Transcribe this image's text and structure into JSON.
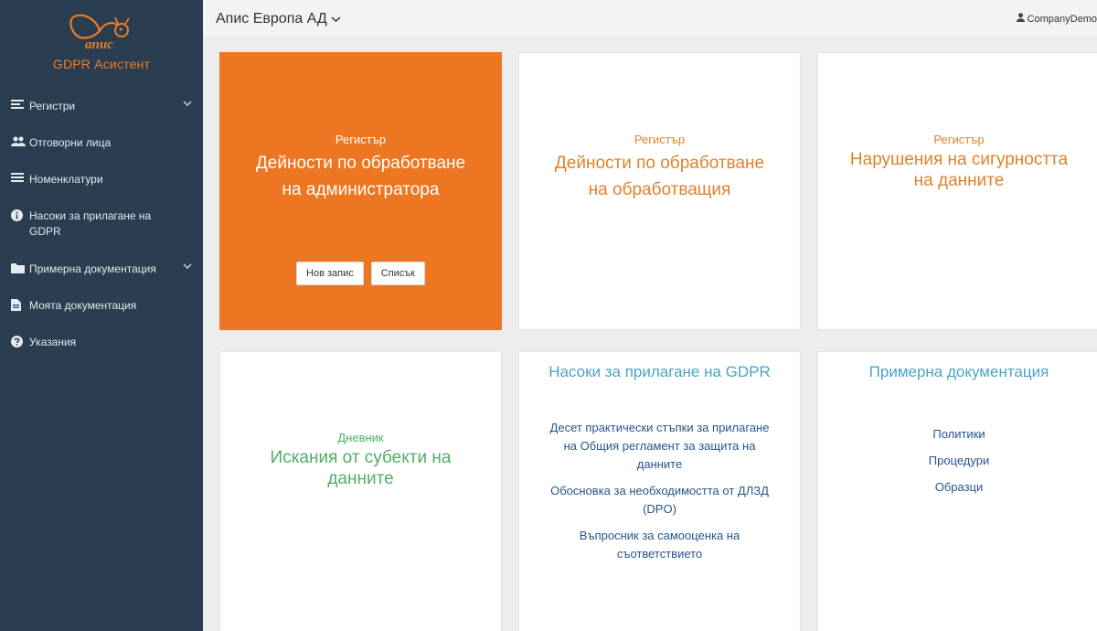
{
  "brand": {
    "logo_text": "апис",
    "title": "GDPR Асистент",
    "accent": "#ef7d22"
  },
  "sidebar": {
    "items": [
      {
        "icon": "list-icon",
        "label": "Регистри",
        "has_chevron": true
      },
      {
        "icon": "users-icon",
        "label": "Отговорни лица"
      },
      {
        "icon": "bars-icon",
        "label": "Номенклатури"
      },
      {
        "icon": "info-circle-icon",
        "label": "Насоки за прилагане на GDPR"
      },
      {
        "icon": "folder-icon",
        "label": "Примерна документация",
        "has_chevron": true
      },
      {
        "icon": "file-icon",
        "label": "Моята документация"
      },
      {
        "icon": "question-circle-icon",
        "label": "Указания"
      }
    ]
  },
  "header": {
    "company": "Апис Европа АД",
    "user": "CompanyDemo"
  },
  "cards": {
    "controller": {
      "pre": "Регистър",
      "title_line1": "Дейности по обработване",
      "title_line2": "на администратора",
      "btn_new": "Нов запис",
      "btn_list": "Списък"
    },
    "processor": {
      "pre": "Регистър",
      "title_line1": "Дейности по обработване",
      "title_line2": "на обработващия"
    },
    "breaches": {
      "pre": "Регистър",
      "title_line1": "Нарушения на сигурността",
      "title_line2": "на данните"
    },
    "requests": {
      "pre": "Дневник",
      "title_line1": "Искания от субекти на",
      "title_line2": "данните"
    },
    "guidance": {
      "title": "Насоки за прилагане на GDPR",
      "links": [
        {
          "l1": "Десет практически стъпки за прилагане",
          "l2": "на Общия регламент за защита на",
          "l3": "данните"
        },
        {
          "l1": "Обосновка за необходимостта от ДЛЗД",
          "l2": "(DPO)"
        },
        {
          "l1": "Въпросник за самооценка на",
          "l2": "съответствието"
        }
      ]
    },
    "samples": {
      "title": "Примерна документация",
      "links": [
        "Политики",
        "Процедури",
        "Образци"
      ]
    }
  }
}
